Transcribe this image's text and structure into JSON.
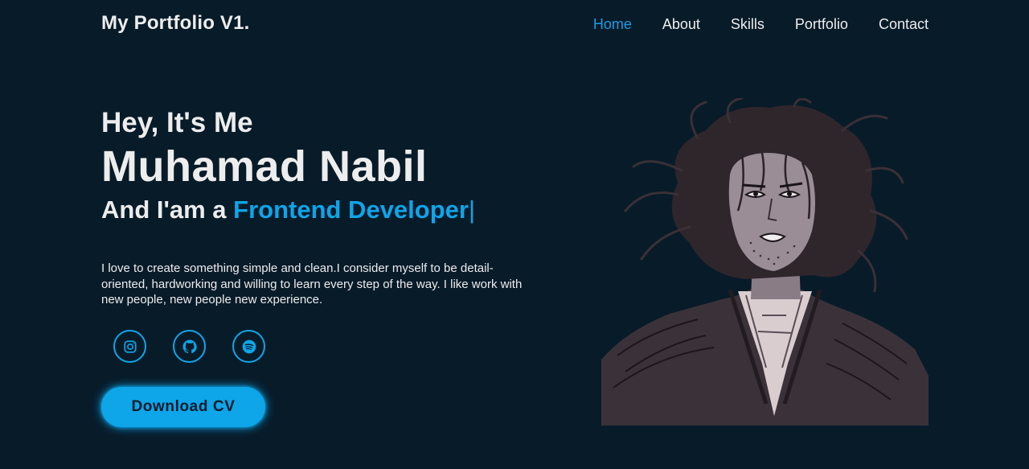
{
  "header": {
    "logo": "My Portfolio V1.",
    "nav": [
      {
        "label": "Home",
        "active": true
      },
      {
        "label": "About",
        "active": false
      },
      {
        "label": "Skills",
        "active": false
      },
      {
        "label": "Portfolio",
        "active": false
      },
      {
        "label": "Contact",
        "active": false
      }
    ]
  },
  "hero": {
    "greeting": "Hey, It's Me",
    "name": "Muhamad Nabil",
    "role_prefix": "And I'am a ",
    "role_highlight": "Frontend Developer",
    "role_cursor": "|",
    "description": "I love to create something simple and clean.I consider myself to be detail-oriented, hardworking and willing to learn every step of the way. I like work with new people, new people new experience.",
    "socials": [
      {
        "icon": "instagram-icon"
      },
      {
        "icon": "github-icon"
      },
      {
        "icon": "spotify-icon"
      }
    ],
    "cta_label": "Download CV"
  },
  "colors": {
    "background": "#081b29",
    "accent": "#0ea5e9",
    "text": "#ededed",
    "nav_active": "#1e9be0"
  }
}
